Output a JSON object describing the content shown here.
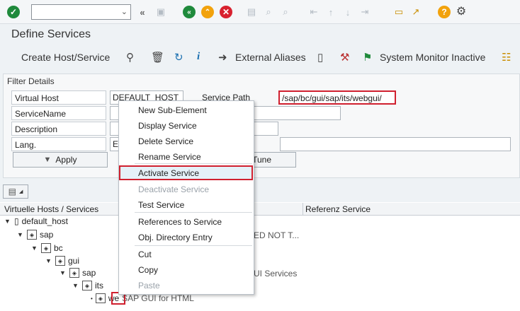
{
  "toolbar": {
    "command_field_value": "",
    "icons": [
      "ok-check-icon",
      "command-dropdown-icon",
      "back-double-icon",
      "save-icon",
      "back-green-icon",
      "exit-up-icon",
      "cancel-icon",
      "print-icon",
      "find-icon",
      "find-next-icon",
      "first-page-icon",
      "prev-page-icon",
      "next-page-icon",
      "last-page-icon",
      "new-session-icon",
      "shortcut-icon",
      "help-icon",
      "settings-icon"
    ]
  },
  "page": {
    "title": "Define Services"
  },
  "app_toolbar": {
    "create_host": "Create Host/Service",
    "external_aliases": "External Aliases",
    "system_monitor": "System Monitor Inactive"
  },
  "filter": {
    "title": "Filter Details",
    "virtual_host_label": "Virtual Host",
    "virtual_host_value": "DEFAULT_HOST",
    "service_path_label": "Service Path",
    "service_path_value": "/sap/bc/gui/sap/its/webgui/",
    "service_name_label": "ServiceName",
    "description_label": "Description",
    "lang_label": "Lang.",
    "lang_value": "E",
    "apply_label": "Apply",
    "fine_tune_label": "-Tune"
  },
  "tree": {
    "col_hosts": "Virtuelle Hosts / Services",
    "col_ref": "Referenz Service",
    "nodes": [
      "default_host",
      "sap",
      "bc",
      "gui",
      "sap",
      "its",
      "we"
    ],
    "leaf_desc": "SAP GUI for HTML",
    "bg_text_1": "ED NOT T...",
    "bg_text_2": "UI Services"
  },
  "context_menu": {
    "items": [
      {
        "label": "New Sub-Element",
        "enabled": true
      },
      {
        "label": "Display Service",
        "enabled": true
      },
      {
        "label": "Delete Service",
        "enabled": true
      },
      {
        "label": "Rename Service",
        "enabled": true
      },
      {
        "label": "Activate Service",
        "enabled": true
      },
      {
        "label": "Deactivate Service",
        "enabled": false
      },
      {
        "label": "Test Service",
        "enabled": true
      },
      {
        "label": "References to Service",
        "enabled": true
      },
      {
        "label": "Obj. Directory Entry",
        "enabled": true
      },
      {
        "label": "Cut",
        "enabled": true
      },
      {
        "label": "Copy",
        "enabled": true
      },
      {
        "label": "Paste",
        "enabled": false
      }
    ]
  },
  "colors": {
    "highlight": "#d0202f",
    "ok_green": "#1f8a3c",
    "cancel_red": "#d8212f",
    "help_orange": "#f2a20c"
  }
}
